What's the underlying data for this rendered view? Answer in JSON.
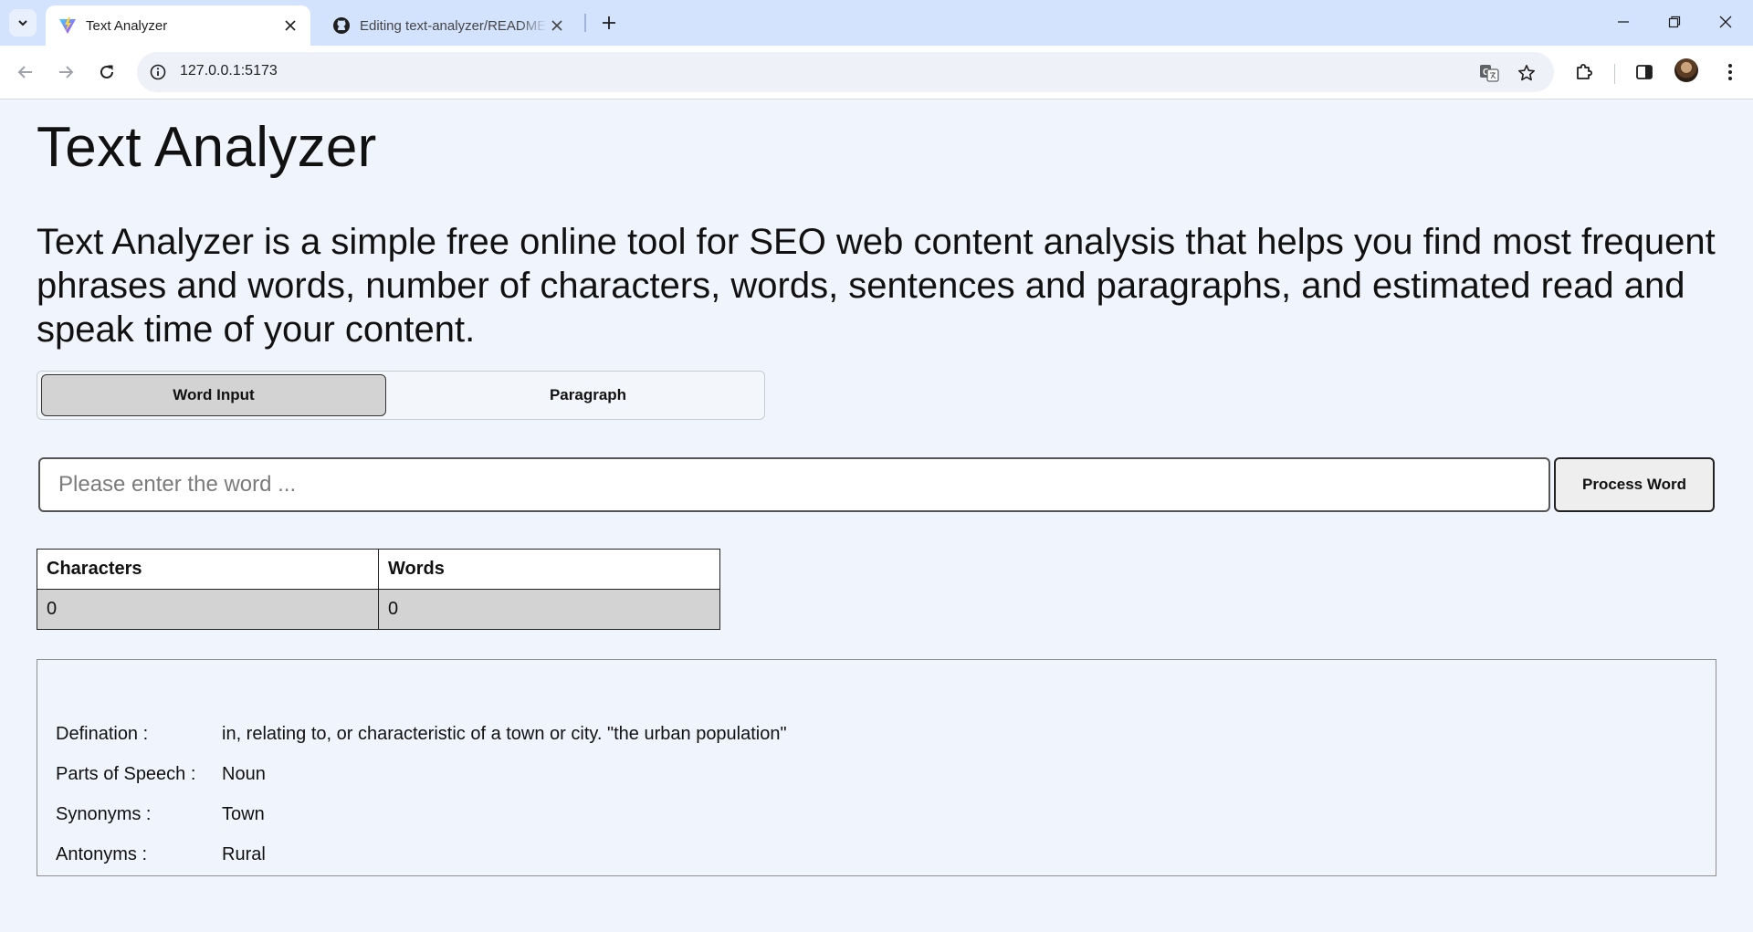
{
  "browser": {
    "tabs": [
      {
        "title": "Text Analyzer",
        "icon": "vite-logo-icon",
        "active": true
      },
      {
        "title": "Editing text-analyzer/README.md",
        "icon": "github-icon",
        "active": false
      }
    ],
    "url": "127.0.0.1:5173"
  },
  "page": {
    "title": "Text Analyzer",
    "description": "Text Analyzer is a simple free online tool for SEO web content analysis that helps you find most frequent phrases and words, number of characters, words, sentences and paragraphs, and estimated read and speak time of your content."
  },
  "mode_tabs": {
    "word_input_label": "Word Input",
    "paragraph_label": "Paragraph",
    "selected": "Word Input"
  },
  "word_input": {
    "placeholder": "Please enter the word ...",
    "value": "",
    "button_label": "Process Word"
  },
  "stats_table": {
    "headers": [
      "Characters",
      "Words"
    ],
    "values": [
      "0",
      "0"
    ]
  },
  "word_info": {
    "definition_label": "Defination :",
    "definition": "in, relating to, or characteristic of a town or city. \"the urban population\"",
    "pos_label": "Parts of Speech :",
    "pos": "Noun",
    "synonyms_label": "Synonyms :",
    "synonyms": "Town",
    "antonyms_label": "Antonyms :",
    "antonyms": "Rural"
  },
  "colors": {
    "page_background": "#f0f5fd",
    "tab_strip": "#d3e3fd",
    "active_mode_tab": "#d3d3d3",
    "table_value_row": "#d3d3d3"
  }
}
